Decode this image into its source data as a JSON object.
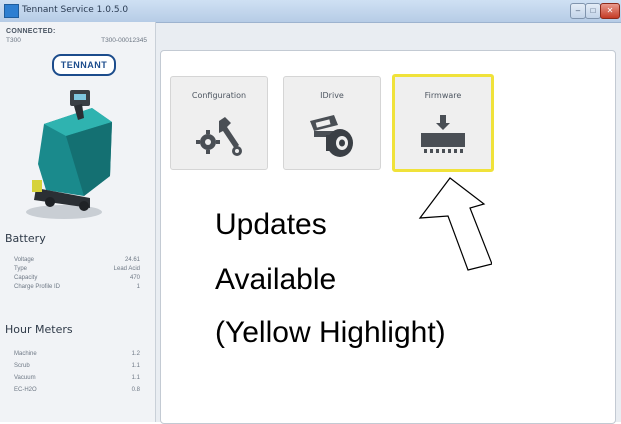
{
  "window": {
    "title": "Tennant Service 1.0.5.0",
    "controls": {
      "minimize": "–",
      "maximize": "□",
      "close": "✕"
    }
  },
  "sidebar": {
    "status": "CONNECTED:",
    "model": "T300",
    "serial": "T300-00012345",
    "logo": "TENNANT",
    "battery": {
      "title": "Battery",
      "rows": [
        {
          "label": "Voltage",
          "value": "24.61"
        },
        {
          "label": "Type",
          "value": "Lead Acid"
        },
        {
          "label": "Capacity",
          "value": "470"
        },
        {
          "label": "Charge Profile ID",
          "value": "1"
        }
      ]
    },
    "hour_meters": {
      "title": "Hour Meters",
      "rows": [
        {
          "label": "Machine",
          "value": "1.2"
        },
        {
          "label": "Scrub",
          "value": "1.1"
        },
        {
          "label": "Vacuum",
          "value": "1.1"
        },
        {
          "label": "EC-H2O",
          "value": "0.8"
        }
      ]
    }
  },
  "tiles": [
    {
      "label": "Configuration",
      "icon": "wrench-gear-icon",
      "highlighted": false
    },
    {
      "label": "IDrive",
      "icon": "idrive-icon",
      "highlighted": false
    },
    {
      "label": "Firmware",
      "icon": "firmware-chip-icon",
      "highlighted": true
    }
  ],
  "annotation": {
    "line1": "Updates",
    "line2": "Available",
    "line3": "(Yellow Highlight)"
  },
  "colors": {
    "highlight": "#f0e23a",
    "logo_blue": "#1c4c8c",
    "machine_teal": "#1a8a8c"
  }
}
